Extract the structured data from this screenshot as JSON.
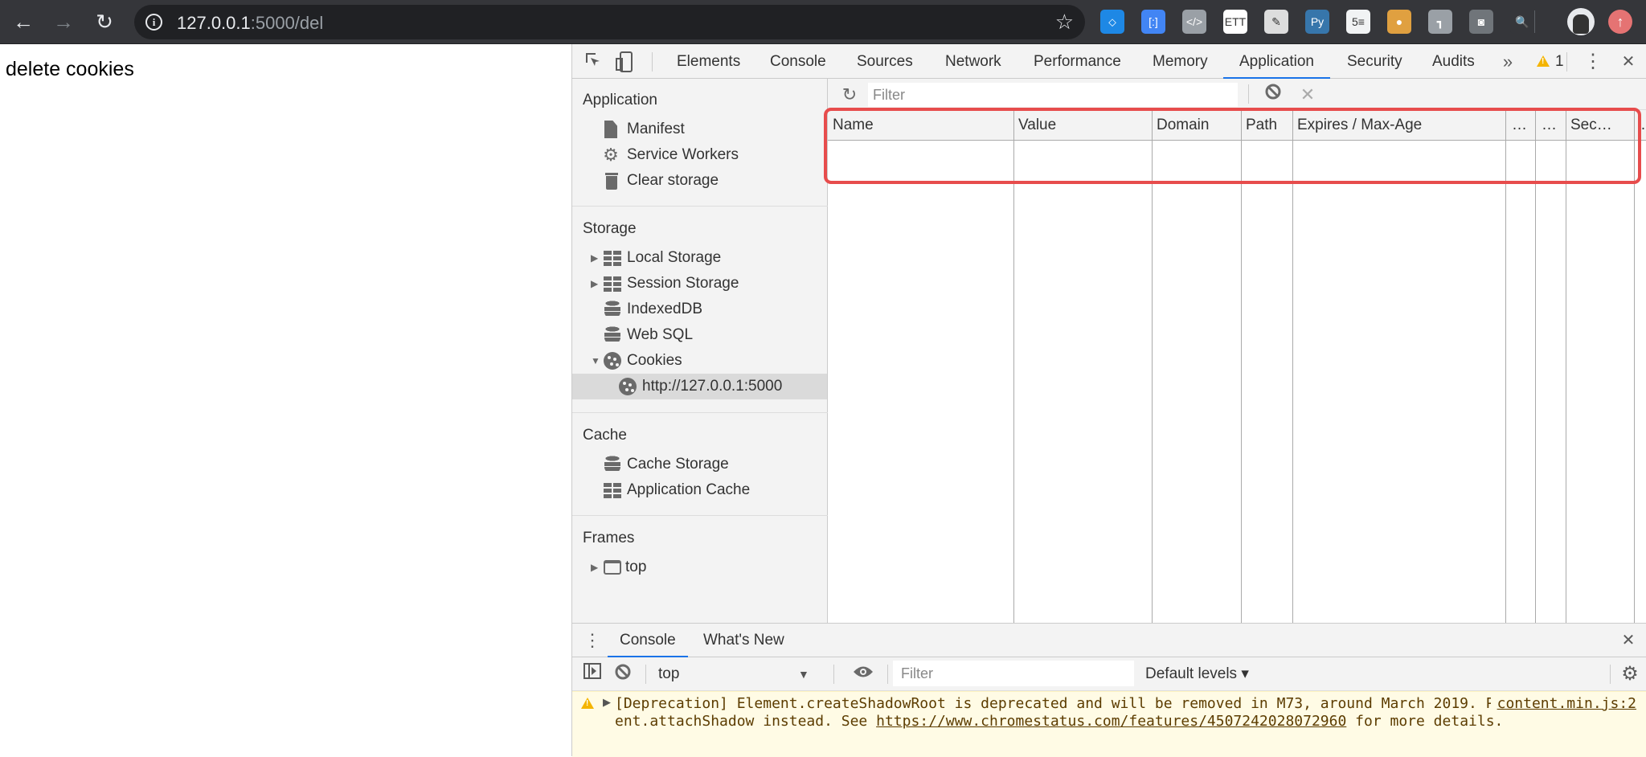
{
  "browser": {
    "url_host": "127.0.0.1",
    "url_rest": ":5000/del",
    "back_icon": "arrow-left-icon",
    "forward_icon": "arrow-right-icon",
    "reload_icon": "reload-icon",
    "info_icon": "info-icon",
    "bookmark_icon": "star-icon",
    "extensions": [
      {
        "name": "balloon-extension-icon",
        "glyph": "⬦",
        "color": "#1e88e5"
      },
      {
        "name": "tag-extension-icon",
        "glyph": "[:]",
        "color": "#4285f4"
      },
      {
        "name": "code-extension-icon",
        "glyph": "</>",
        "color": "#9aa0a6"
      },
      {
        "name": "ett-extension-icon",
        "glyph": "ETT",
        "color": "#ffffff"
      },
      {
        "name": "note-extension-icon",
        "glyph": "✎",
        "color": "#dddddd"
      },
      {
        "name": "python-extension-icon",
        "glyph": "Py",
        "color": "#3776ab"
      },
      {
        "name": "sheet-extension-icon",
        "glyph": "5≡",
        "color": "#f1f3f4"
      },
      {
        "name": "cookie-extension-icon",
        "glyph": "●",
        "color": "#e0a040"
      },
      {
        "name": "tool-extension-icon",
        "glyph": "┓",
        "color": "#9aa0a6"
      },
      {
        "name": "record-extension-icon",
        "glyph": "◙",
        "color": "#70757a"
      },
      {
        "name": "magnifier-extension-icon",
        "glyph": "🔍",
        "color": "#35363a"
      }
    ],
    "profile_icon": "profile-avatar-icon",
    "update_icon": "update-arrow-icon",
    "update_glyph": "↑"
  },
  "page": {
    "title": "delete cookies"
  },
  "devtools": {
    "tabs": [
      "Elements",
      "Console",
      "Sources",
      "Network",
      "Performance",
      "Memory",
      "Application",
      "Security",
      "Audits"
    ],
    "active_tab": "Application",
    "more_tabs_glyph": "»",
    "warning_count": "1",
    "inspect_glyph": "⬚",
    "device_glyph": "▯",
    "menu_glyph": "⋮",
    "close_glyph": "✕"
  },
  "sidebar": {
    "sections": [
      {
        "title": "Application",
        "items": [
          {
            "label": "Manifest",
            "icon": "manifest-icon"
          },
          {
            "label": "Service Workers",
            "icon": "gear-icon"
          },
          {
            "label": "Clear storage",
            "icon": "trash-icon"
          }
        ]
      },
      {
        "title": "Storage",
        "items": [
          {
            "label": "Local Storage",
            "icon": "grid-icon",
            "expander": "collapsed"
          },
          {
            "label": "Session Storage",
            "icon": "grid-icon",
            "expander": "collapsed"
          },
          {
            "label": "IndexedDB",
            "icon": "database-icon"
          },
          {
            "label": "Web SQL",
            "icon": "database-icon"
          },
          {
            "label": "Cookies",
            "icon": "cookie-icon",
            "expander": "expanded"
          },
          {
            "label": "http://127.0.0.1:5000",
            "icon": "cookie-icon",
            "selected": true,
            "child": true
          }
        ]
      },
      {
        "title": "Cache",
        "items": [
          {
            "label": "Cache Storage",
            "icon": "database-icon"
          },
          {
            "label": "Application Cache",
            "icon": "grid-icon"
          }
        ]
      },
      {
        "title": "Frames",
        "items": [
          {
            "label": "top",
            "icon": "frame-icon",
            "expander": "collapsed"
          }
        ]
      }
    ]
  },
  "cookies": {
    "filter_placeholder": "Filter",
    "refresh_glyph": "↻",
    "clear_all_glyph": "⃠",
    "delete_glyph": "✕",
    "columns": [
      "Name",
      "Value",
      "Domain",
      "Path",
      "Expires / Max-Age",
      "…",
      "…",
      "Sec…",
      "…"
    ],
    "rows": []
  },
  "drawer": {
    "tabs": [
      "Console",
      "What's New"
    ],
    "active_tab": "Console",
    "context": "top",
    "filter_placeholder": "Filter",
    "levels": "Default levels ▾",
    "message": {
      "level": "warning",
      "text_before_link": "[Deprecation] Element.createShadowRoot is deprecated and will be removed in M73, around March 2019. Please use Element.attachShadow instead. See ",
      "link": "https://www.chromestatus.com/features/4507242028072960",
      "text_after_link": " for more details.",
      "source": "content.min.js:2"
    }
  }
}
